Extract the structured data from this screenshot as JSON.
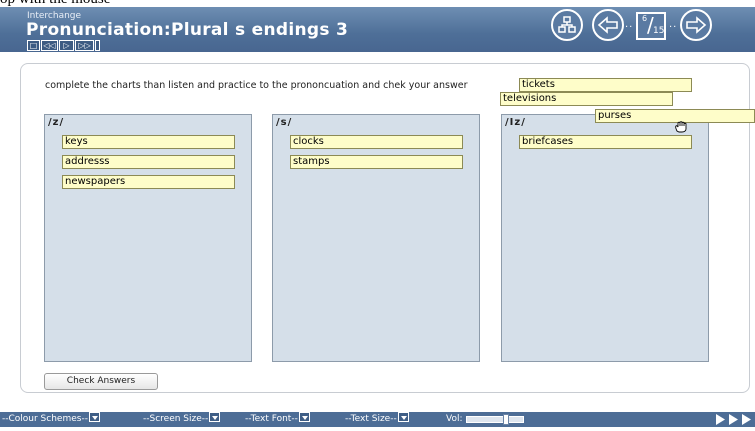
{
  "cut_caption": "op with the mouse",
  "header": {
    "app_name": "Interchange",
    "title": "Pronunciation:Plural s endings 3",
    "mini_controls": [
      "□",
      "◁◁",
      "▷",
      "▷▷"
    ],
    "page_current": "6",
    "page_total": "15"
  },
  "activity": {
    "instructions": "complete the charts than listen and practice to the prononcuation and chek your answer",
    "columns": [
      {
        "heading": "/z/",
        "words": [
          "keys",
          "addresss",
          "newspapers"
        ]
      },
      {
        "heading": "/s/",
        "words": [
          "clocks",
          "stamps"
        ]
      },
      {
        "heading": "/Iz/",
        "words": [
          "briefcases"
        ]
      }
    ],
    "word_bank": [
      "tickets",
      "televisions",
      "purses"
    ],
    "check_button": "Check Answers"
  },
  "bottom_bar": {
    "colour_schemes": "--Colour Schemes--",
    "screen_size": "--Screen Size--",
    "text_font": "--Text Font--",
    "text_size": "--Text Size--",
    "volume_label": "Vol:",
    "volume_level": 0.65
  },
  "colors": {
    "header": "#4e6f98",
    "column_bg": "#d5dfe9",
    "word_bg": "#fefdc9"
  },
  "icons": [
    "sitemap-icon",
    "back-arrow-icon",
    "next-arrow-icon",
    "hand-cursor-icon",
    "play-arrows-icon"
  ]
}
